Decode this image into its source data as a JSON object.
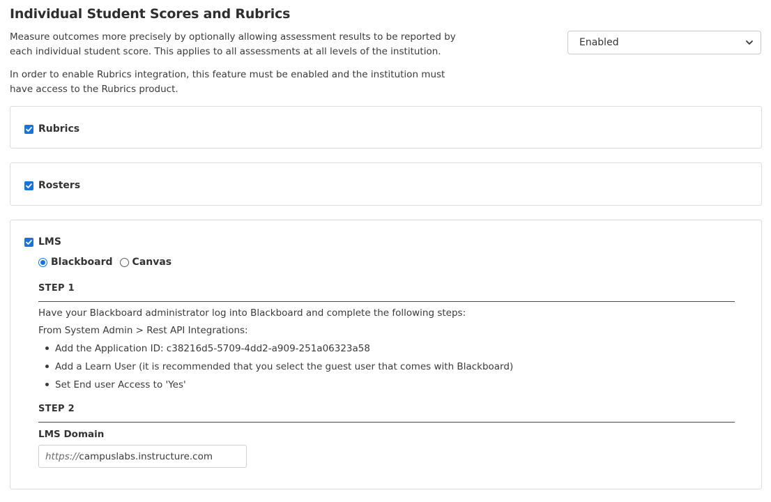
{
  "section": {
    "title": "Individual Student Scores and Rubrics",
    "description_1": "Measure outcomes more precisely by optionally allowing assessment results to be reported by each individual student score. This applies to all assessments at all levels of the institution.",
    "description_2": "In order to enable Rubrics integration, this feature must be enabled and the institution must have access to the Rubrics product."
  },
  "status_select": {
    "value": "Enabled",
    "icon": "chevron-down-icon"
  },
  "panels": {
    "rubrics": {
      "label": "Rubrics",
      "checked": true
    },
    "rosters": {
      "label": "Rosters",
      "checked": true
    },
    "lms": {
      "label": "LMS",
      "checked": true,
      "radio_options": [
        {
          "label": "Blackboard",
          "selected": true
        },
        {
          "label": "Canvas",
          "selected": false
        }
      ],
      "step1": {
        "heading": "STEP 1",
        "intro": "Have your Blackboard administrator log into Blackboard and complete the following steps:",
        "path": "From System Admin > Rest API Integrations:",
        "bullets": [
          "Add the Application ID: c38216d5-5709-4dd2-a909-251a06323a58",
          "Add a Learn User (it is recommended that you select the guest user that comes with Blackboard)",
          "Set End user Access to 'Yes'"
        ]
      },
      "step2": {
        "heading": "STEP 2",
        "field_label": "LMS Domain",
        "field_prefix": "https://",
        "field_value": "campuslabs.instructure.com"
      }
    }
  },
  "colors": {
    "accent": "#1a73d8",
    "text": "#333333",
    "border": "#dcdcdc"
  }
}
